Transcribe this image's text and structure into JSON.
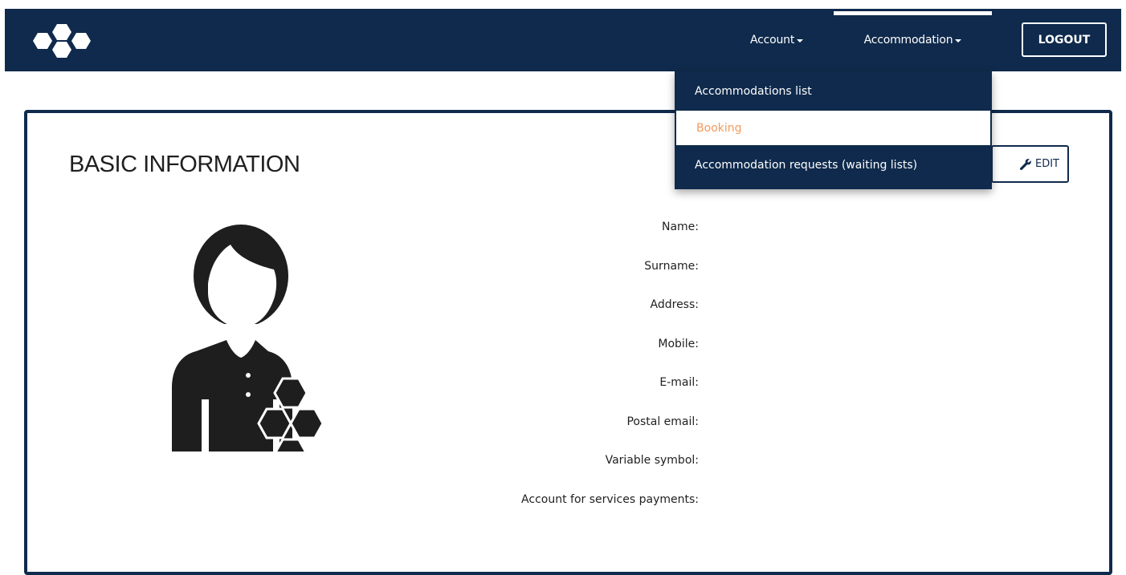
{
  "navbar": {
    "logo_name": "honeycomb-logo",
    "account_label": "Account",
    "accommodation_label": "Accommodation",
    "logout_label": "LOGOUT"
  },
  "dropdown": {
    "items": [
      {
        "label": "Accommodations list"
      },
      {
        "label": "Booking"
      },
      {
        "label": "Accommodation requests (waiting lists)"
      }
    ],
    "active_index": 1
  },
  "card": {
    "title": "BASIC INFORMATION",
    "edit_label": "EDIT",
    "edit_icon": "wrench-icon",
    "avatar_icon": "user-honeycomb-icon",
    "fields": [
      {
        "label": "Name:"
      },
      {
        "label": "Surname:"
      },
      {
        "label": "Address:"
      },
      {
        "label": "Mobile:"
      },
      {
        "label": "E-mail:"
      },
      {
        "label": "Postal email:"
      },
      {
        "label": "Variable symbol:"
      },
      {
        "label": "Account for services payments:"
      }
    ]
  },
  "colors": {
    "primary": "#0f2a4c",
    "active_item": "#f29a5c",
    "background": "#ffffff"
  }
}
